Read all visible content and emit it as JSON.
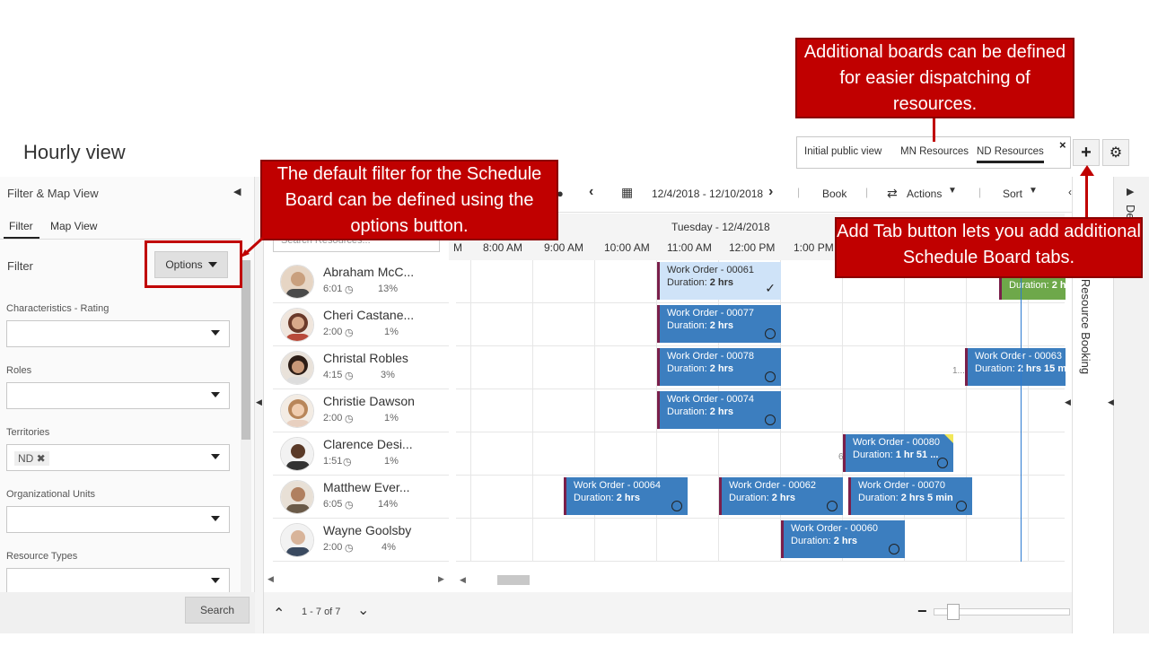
{
  "page": {
    "title": "Hourly view"
  },
  "board_tabs": {
    "items": [
      "Initial public view",
      "MN Resources",
      "ND Resources"
    ],
    "active_index": 2,
    "close": "×",
    "add": "+",
    "settings": "⚙"
  },
  "left_panel": {
    "title": "Filter & Map View",
    "collapse": "◀",
    "tabs": [
      "Filter",
      "Map View"
    ],
    "filter_label": "Filter",
    "options_label": "Options",
    "fields": [
      {
        "label": "Characteristics - Rating",
        "value": ""
      },
      {
        "label": "Roles",
        "value": ""
      },
      {
        "label": "Territories",
        "value": "ND ✖"
      },
      {
        "label": "Organizational Units",
        "value": ""
      },
      {
        "label": "Resource Types",
        "value": ""
      }
    ],
    "search_label": "Search"
  },
  "toolbar": {
    "date_range": "12/4/2018 - 12/10/2018",
    "book": "Book",
    "actions": "Actions",
    "sort": "Sort"
  },
  "timeline": {
    "day": "Tuesday - 12/4/2018",
    "hours": [
      "M",
      "8:00 AM",
      "9:00 AM",
      "10:00 AM",
      "11:00 AM",
      "12:00 PM",
      "1:00 PM"
    ]
  },
  "resource_search_placeholder": "Search Resources...",
  "resources": [
    {
      "name": "Abraham McC...",
      "hours": "6:01",
      "pct": "13%"
    },
    {
      "name": "Cheri Castane...",
      "hours": "2:00",
      "pct": "1%"
    },
    {
      "name": "Christal Robles",
      "hours": "4:15",
      "pct": "3%"
    },
    {
      "name": "Christie Dawson",
      "hours": "2:00",
      "pct": "1%"
    },
    {
      "name": "Clarence Desi...",
      "hours": "1:51",
      "pct": "1%"
    },
    {
      "name": "Matthew Ever...",
      "hours": "6:05",
      "pct": "14%"
    },
    {
      "name": "Wayne Goolsby",
      "hours": "2:00",
      "pct": "4%"
    }
  ],
  "bookings": [
    {
      "title": "Work Order - 00061",
      "duration": "2 hrs"
    },
    {
      "title": "",
      "duration": "2 hr"
    },
    {
      "title": "Work Order - 00077",
      "duration": "2 hrs"
    },
    {
      "title": "Work Order - 00078",
      "duration": "2 hrs"
    },
    {
      "title": "Work Order - 00063",
      "duration": "2 hrs 15 mi"
    },
    {
      "title": "Work Order - 00074",
      "duration": "2 hrs"
    },
    {
      "title": "Work Order - 00080",
      "duration": "1 hr 51 ..."
    },
    {
      "title": "Work Order - 00064",
      "duration": "2 hrs"
    },
    {
      "title": "Work Order - 00062",
      "duration": "2 hrs"
    },
    {
      "title": "Work Order - 00070",
      "duration": "2 hrs 5 min"
    },
    {
      "title": "Work Order - 00060",
      "duration": "2 hrs"
    }
  ],
  "duration_prefix": "Duration: ",
  "grid_side_labels": [
    "1...",
    "6"
  ],
  "footer": {
    "pager": "1 - 7 of 7",
    "zoom_minus": "−",
    "zoom_plus": "+"
  },
  "right_sidebar": {
    "label": "e Resource Booking",
    "top_letters": "De"
  },
  "callouts": {
    "boards": "Additional boards can be defined for easier dispatching of resources.",
    "filter": "The default filter for the Schedule Board can be defined using the options button.",
    "addtab": "Add Tab button lets you add additional Schedule Board tabs."
  }
}
